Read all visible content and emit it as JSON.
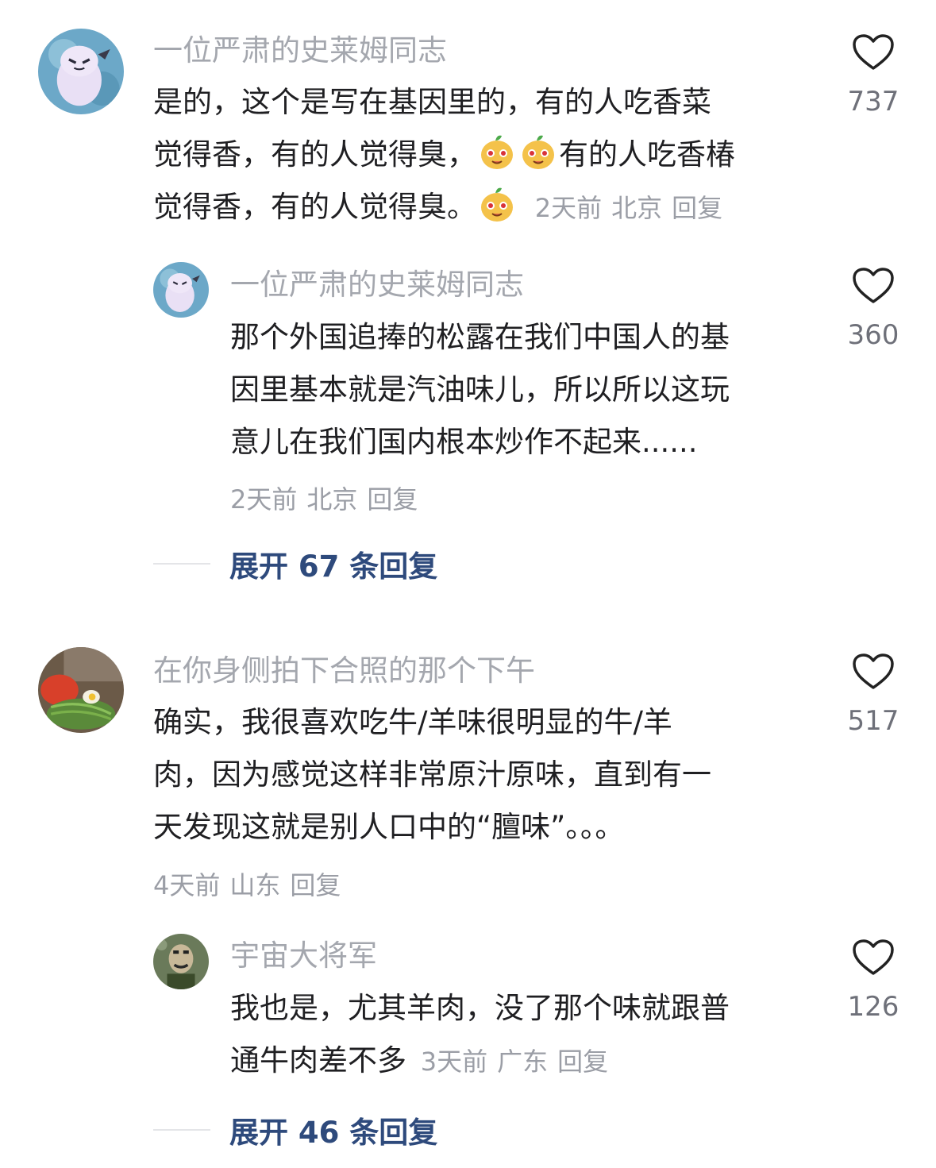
{
  "comments": [
    {
      "username": "一位严肃的史莱姆同志",
      "text_line1": "是的，这个是写在基因里的，有的人吃香菜",
      "text_line2a": "觉得香，有的人觉得臭，",
      "text_line2b": "有的人吃香椿",
      "text_line3": "觉得香，有的人觉得臭。",
      "time": "2天前",
      "location": "北京",
      "reply": "回复",
      "likes": "737",
      "replies": [
        {
          "username": "一位严肃的史莱姆同志",
          "text_line1": "那个外国追捧的松露在我们中国人的基",
          "text_line2": "因里基本就是汽油味儿，所以所以这玩",
          "text_line3": "意儿在我们国内根本炒作不起来......",
          "time": "2天前",
          "location": "北京",
          "reply": "回复",
          "likes": "360"
        }
      ],
      "expand_label": "展开 67 条回复"
    },
    {
      "username": "在你身侧拍下合照的那个下午",
      "text_line1": "确实，我很喜欢吃牛/羊味很明显的牛/羊",
      "text_line2": "肉，因为感觉这样非常原汁原味，直到有一",
      "text_line3": "天发现这就是别人口中的“膻味”。。。",
      "time": "4天前",
      "location": "山东",
      "reply": "回复",
      "likes": "517",
      "replies": [
        {
          "username": "宇宙大将军",
          "text_line1": "我也是，尤其羊肉，没了那个味就跟普",
          "text_line2": "通牛肉差不多",
          "time": "3天前",
          "location": "广东",
          "reply": "回复",
          "likes": "126"
        }
      ],
      "expand_label": "展开 46 条回复"
    }
  ],
  "icons": {
    "like": "heart-outline-icon",
    "emoji": "drooling-face-emoji"
  },
  "colors": {
    "username": "#a4a7ae",
    "meta": "#9b9ea6",
    "expand": "#2e4a7c",
    "text": "#1f1f22"
  }
}
